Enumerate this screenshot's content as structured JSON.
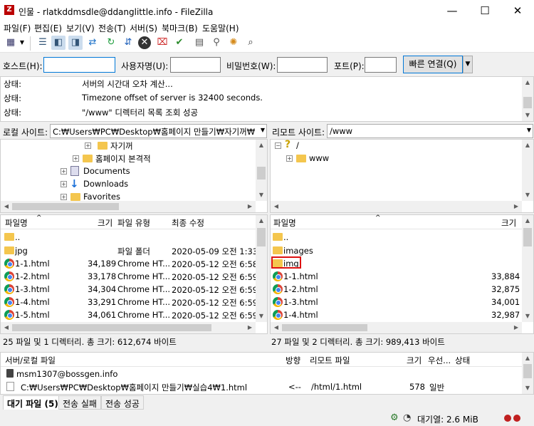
{
  "window": {
    "title": "인물 - rlatkddmsdle@ddanglittle.info - FileZilla",
    "minimize": "—",
    "maximize": "☐",
    "close": "✕"
  },
  "menu": [
    "파일(F)",
    "편집(E)",
    "보기(V)",
    "전송(T)",
    "서버(S)",
    "북마크(B)",
    "도움말(H)"
  ],
  "toolbar_icons": [
    "site-manager-icon",
    "dropdown-icon",
    "toggle-log-icon",
    "toggle-local-tree-icon",
    "toggle-remote-tree-icon",
    "toggle-queue-icon",
    "refresh-icon",
    "process-queue-icon",
    "cancel-icon",
    "disconnect-icon",
    "reconnect-icon",
    "directory-listing-filters-icon",
    "compare-icon",
    "sync-browse-icon",
    "find-files-icon"
  ],
  "quickconnect": {
    "host_label": "호스트(H):",
    "host_value": "",
    "user_label": "사용자명(U):",
    "user_value": "",
    "pass_label": "비밀번호(W):",
    "pass_value": "",
    "port_label": "포트(P):",
    "port_value": "",
    "connect_label": "빠른 연결(Q)"
  },
  "log": [
    {
      "label": "상태:",
      "msg": "서버의 시간대 오차 계산..."
    },
    {
      "label": "상태:",
      "msg": "Timezone offset of server is 32400 seconds."
    },
    {
      "label": "상태:",
      "msg": "\"/www\" 디렉터리 목록 조회 성공"
    }
  ],
  "local": {
    "path_label": "로컬 사이트:",
    "path_value": "C:₩Users₩PC₩Desktop₩홈페이지 만들기₩자기꺼₩",
    "tree": [
      {
        "label": "자기꺼",
        "type": "folder"
      },
      {
        "label": "홈페이지 본격적",
        "type": "folder"
      },
      {
        "label": "Documents",
        "type": "documents"
      },
      {
        "label": "Downloads",
        "type": "downloads"
      },
      {
        "label": "Favorites",
        "type": "folder"
      }
    ],
    "columns": [
      "파일명",
      "크기",
      "파일 유형",
      "최종 수정"
    ],
    "files": [
      {
        "name": "..",
        "size": "",
        "type": "",
        "modified": "",
        "icon": "folder"
      },
      {
        "name": "jpg",
        "size": "",
        "type": "파일 폴더",
        "modified": "2020-05-09 오전 1:33:",
        "icon": "folder"
      },
      {
        "name": "1-1.html",
        "size": "34,189",
        "type": "Chrome HT...",
        "modified": "2020-05-12 오전 6:58:",
        "icon": "chrome"
      },
      {
        "name": "1-2.html",
        "size": "33,178",
        "type": "Chrome HT...",
        "modified": "2020-05-12 오전 6:59:",
        "icon": "chrome"
      },
      {
        "name": "1-3.html",
        "size": "34,304",
        "type": "Chrome HT...",
        "modified": "2020-05-12 오전 6:59:",
        "icon": "chrome"
      },
      {
        "name": "1-4.html",
        "size": "33,291",
        "type": "Chrome HT...",
        "modified": "2020-05-12 오전 6:59:",
        "icon": "chrome"
      },
      {
        "name": "1-5.html",
        "size": "34,061",
        "type": "Chrome HT...",
        "modified": "2020-05-12 오전 6:59:",
        "icon": "chrome"
      }
    ],
    "status": "25 파일 및 1 디렉터리. 총 크기: 612,674 바이트"
  },
  "remote": {
    "path_label": "리모트 사이트:",
    "path_value": "/www",
    "tree": [
      {
        "label": "/",
        "type": "unknown"
      },
      {
        "label": "www",
        "type": "folder"
      }
    ],
    "columns": [
      "파일명",
      "크기"
    ],
    "files": [
      {
        "name": "..",
        "size": "",
        "icon": "folder"
      },
      {
        "name": "images",
        "size": "",
        "icon": "folder"
      },
      {
        "name": "img",
        "size": "",
        "icon": "folder"
      },
      {
        "name": "1-1.html",
        "size": "33,884",
        "icon": "chrome"
      },
      {
        "name": "1-2.html",
        "size": "32,875",
        "icon": "chrome"
      },
      {
        "name": "1-3.html",
        "size": "34,001",
        "icon": "chrome"
      },
      {
        "name": "1-4.html",
        "size": "32,987",
        "icon": "chrome"
      }
    ],
    "status": "27 파일 및 2 디렉터리. 총 크기: 989,413 바이트"
  },
  "queue": {
    "columns": [
      "서버/로컬 파일",
      "방향",
      "리모트 파일",
      "크기",
      "우선...",
      "상태"
    ],
    "server": "msm1307@bossgen.info",
    "item": {
      "local": "C:₩Users₩PC₩Desktop₩홈페이지 만들기₩실습4₩1.html",
      "direction": "<--",
      "remote": "/html/1.html",
      "size": "578",
      "priority": "일반"
    }
  },
  "tabs": [
    "대기 파일 (5)",
    "전송 실패",
    "전송 성공"
  ],
  "statusbar": {
    "queue_label": "대기열: 2.6 MiB"
  },
  "colors": {
    "connect_border": "#0078d7",
    "highlight": "#dd1111",
    "folder": "#f4c64e"
  }
}
